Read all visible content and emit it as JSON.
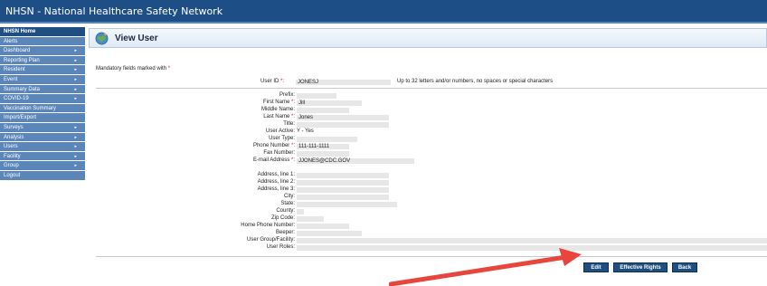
{
  "app": {
    "title": "NHSN - National Healthcare Safety Network"
  },
  "sidebar": {
    "items": [
      {
        "label": "NHSN Home",
        "chevron": false
      },
      {
        "label": "Alerts",
        "chevron": false
      },
      {
        "label": "Dashboard",
        "chevron": true
      },
      {
        "label": "Reporting Plan",
        "chevron": true
      },
      {
        "label": "Resident",
        "chevron": true
      },
      {
        "label": "Event",
        "chevron": true
      },
      {
        "label": "Summary Data",
        "chevron": true
      },
      {
        "label": "COVID-19",
        "chevron": true
      },
      {
        "label": "Vaccination Summary",
        "chevron": false
      },
      {
        "label": "Import/Export",
        "chevron": false
      },
      {
        "label": "Surveys",
        "chevron": true
      },
      {
        "label": "Analysis",
        "chevron": true
      },
      {
        "label": "Users",
        "chevron": true
      },
      {
        "label": "Facility",
        "chevron": true
      },
      {
        "label": "Group",
        "chevron": true
      },
      {
        "label": "Logout",
        "chevron": false
      }
    ],
    "chevron_glyph": "▸"
  },
  "page": {
    "title": "View User",
    "mandatory_note": "Mandatory fields marked with",
    "required_star": "*"
  },
  "user_id": {
    "label": "User ID",
    "value": "JONESJ",
    "hint": "Up to 32 letters and/or numbers, no spaces or special characters"
  },
  "fields": {
    "prefix": {
      "label": "Prefix:",
      "value": ""
    },
    "first_name": {
      "label": "First Name",
      "value": "Jill"
    },
    "middle_name": {
      "label": "Middle Name:",
      "value": ""
    },
    "last_name": {
      "label": "Last Name",
      "value": "Jones"
    },
    "title": {
      "label": "Title:",
      "value": ""
    },
    "user_active": {
      "label": "User Active:",
      "value": "Y - Yes"
    },
    "user_type": {
      "label": "User Type:",
      "value": ""
    },
    "phone_number": {
      "label": "Phone Number",
      "value": "111-111-1111"
    },
    "fax_number": {
      "label": "Fax Number:",
      "value": ""
    },
    "email": {
      "label": "E-mail Address",
      "value": "JJONES@CDC.GOV"
    },
    "address1": {
      "label": "Address, line 1:",
      "value": ""
    },
    "address2": {
      "label": "Address, line 2:",
      "value": ""
    },
    "address3": {
      "label": "Address, line 3:",
      "value": ""
    },
    "city": {
      "label": "City:",
      "value": ""
    },
    "state": {
      "label": "State:",
      "value": ""
    },
    "county": {
      "label": "County:",
      "value": ""
    },
    "zip": {
      "label": "Zip Code:",
      "value": ""
    },
    "home_phone": {
      "label": "Home Phone Number:",
      "value": ""
    },
    "beeper": {
      "label": "Beeper:",
      "value": ""
    },
    "user_group": {
      "label": "User Group/Facility:",
      "value": ""
    },
    "user_roles": {
      "label": "User Roles:",
      "value": ""
    }
  },
  "buttons": {
    "edit": "Edit",
    "effective_rights": "Effective Rights",
    "back": "Back"
  },
  "colors": {
    "header": "#1d4f86",
    "sidebar": "#5b86b9",
    "button": "#1f4e80",
    "required": "#e02020",
    "annotation_arrow": "#e8453c"
  },
  "icons": {
    "page_icon": "globe-icon",
    "annotation": "red-arrow-annotation"
  }
}
